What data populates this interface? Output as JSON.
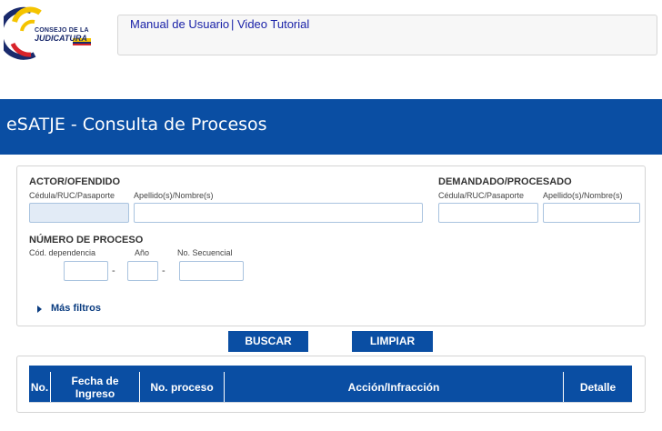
{
  "header": {
    "logo": {
      "line1": "CONSEJO DE LA",
      "line2": "JUDICATURA"
    },
    "links": {
      "manual": "Manual de Usuario",
      "separator": "|",
      "tutorial": "Video Tutorial"
    }
  },
  "banner": {
    "title": "eSATJE - Consulta de Procesos"
  },
  "form": {
    "actor": {
      "title": "ACTOR/OFENDIDO",
      "id_label": "Cédula/RUC/Pasaporte",
      "name_label": "Apellido(s)/Nombre(s)",
      "id_value": "",
      "name_value": ""
    },
    "demandado": {
      "title": "DEMANDADO/PROCESADO",
      "id_label": "Cédula/RUC/Pasaporte",
      "name_label": "Apellido(s)/Nombre(s)",
      "id_value": "",
      "name_value": ""
    },
    "proceso": {
      "title": "NÚMERO DE PROCESO",
      "dep_label": "Cód. dependencia",
      "year_label": "Año",
      "seq_label": "No. Secuencial",
      "dash": "-",
      "dep_value": "",
      "year_value": "",
      "seq_value": ""
    },
    "more_filters": "Más filtros"
  },
  "buttons": {
    "search": "BUSCAR",
    "clear": "LIMPIAR"
  },
  "results": {
    "columns": [
      "No.",
      "Fecha de Ingreso",
      "No. proceso",
      "Acción/Infracción",
      "Detalle"
    ]
  },
  "colors": {
    "primary": "#0a4ea3",
    "link": "#1a22a8",
    "selected_input": "#e2ebf6"
  },
  "icons": {
    "logo": "consejo-judicatura-logo",
    "more_filters": "caret-right-icon"
  }
}
